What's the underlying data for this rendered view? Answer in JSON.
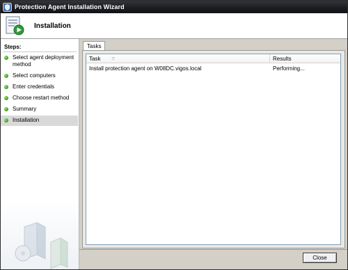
{
  "window": {
    "title": "Protection Agent Installation Wizard",
    "title_icon": "shield-icon"
  },
  "header": {
    "title": "Installation",
    "icon": "installation-wizard-icon"
  },
  "sidebar": {
    "heading": "Steps:",
    "steps": [
      {
        "label": "Select agent deployment method",
        "status": "complete"
      },
      {
        "label": "Select computers",
        "status": "complete"
      },
      {
        "label": "Enter credentials",
        "status": "complete"
      },
      {
        "label": "Choose restart method",
        "status": "complete"
      },
      {
        "label": "Summary",
        "status": "complete"
      },
      {
        "label": "Installation",
        "status": "current"
      }
    ],
    "art": "servers-illustration"
  },
  "tabs": [
    {
      "label": "Tasks",
      "selected": true
    }
  ],
  "tasks_table": {
    "columns": [
      "Task",
      "Results"
    ],
    "rows": [
      {
        "task": "Install protection agent on W08DC.vigos.local",
        "result": "Performing..."
      }
    ]
  },
  "footer": {
    "close_label": "Close"
  },
  "colors": {
    "titlebar": "#1d1e22",
    "step_dot": "#3fa321",
    "active_step_bg": "#d9d9d9",
    "dialog_bg": "#d4d0c8"
  }
}
